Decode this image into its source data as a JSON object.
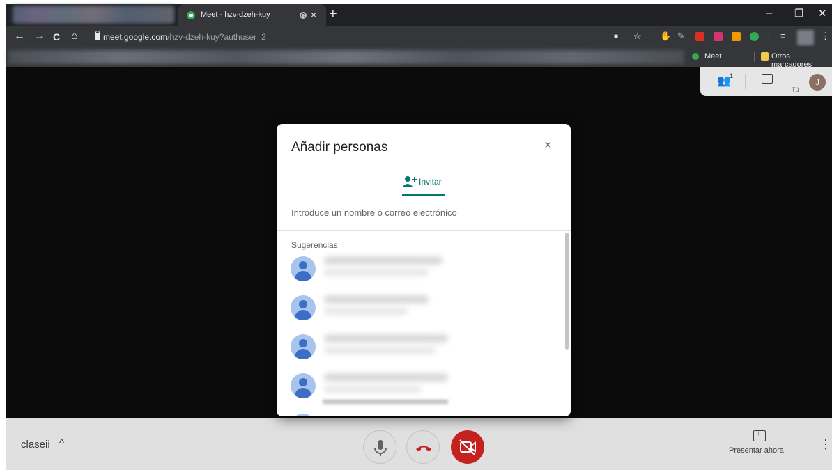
{
  "browser": {
    "tab_title": "Meet - hzv-dzeh-kuy",
    "tab_close": "×",
    "new_tab": "+",
    "url_host": "meet.google.com",
    "url_path": "/hzv-dzeh-kuy?authuser=2",
    "window": {
      "minimize": "–",
      "restore": "❐",
      "close": "✕"
    },
    "nav": {
      "back": "←",
      "forward": "→",
      "reload": "C",
      "home": "⌂"
    }
  },
  "bookmarks": {
    "items": [
      "Meet",
      "Otros marcadores"
    ]
  },
  "meet": {
    "people_count": "1",
    "you_label": "Tú",
    "avatar_initial": "J",
    "meeting_name": "claseii",
    "chevron": "^",
    "present_label": "Presentar ahora",
    "more": "⋮"
  },
  "dialog": {
    "title": "Añadir personas",
    "close": "×",
    "tab_invite": "Invitar",
    "search_placeholder": "Introduce un nombre o correo electrónico",
    "suggestions_label": "Sugerencias",
    "suggestion_count_visible": 4
  },
  "colors": {
    "accent": "#00796b",
    "end_call": "#c5221f",
    "avatar_blue": "#a7c4ed"
  }
}
